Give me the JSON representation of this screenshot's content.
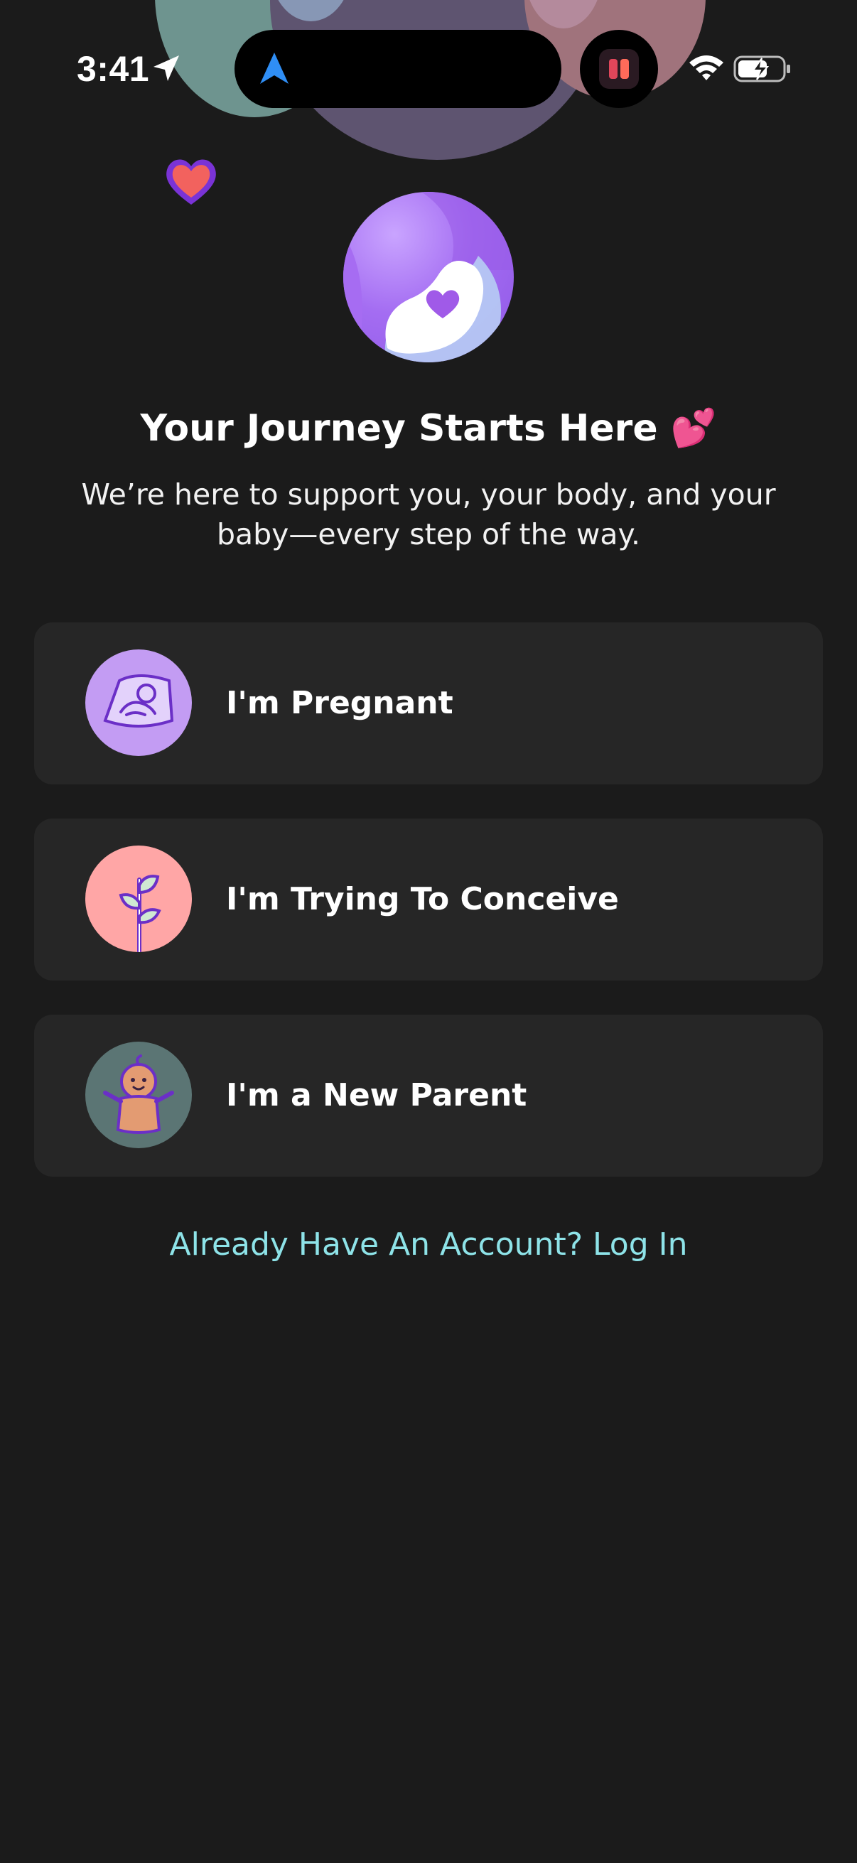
{
  "status_bar": {
    "time": "3:41",
    "icons": [
      "location-arrow-icon",
      "navigation-arrow-icon",
      "app-activity-icon",
      "wifi-icon",
      "battery-charging-icon"
    ]
  },
  "hero": {
    "icon": "pregnant-belly-heart-icon",
    "title": "Your Journey Starts Here 💕",
    "subtitle": "We’re here to support you, your body, and your baby—every step of the way."
  },
  "options": [
    {
      "label": "I'm Pregnant",
      "icon": "ultrasound-icon",
      "icon_bg": "#c39cf3"
    },
    {
      "label": "I'm Trying To Conceive",
      "icon": "sprout-icon",
      "icon_bg": "#ffa6a6"
    },
    {
      "label": "I'm a New Parent",
      "icon": "baby-icon",
      "icon_bg": "#5b7574"
    }
  ],
  "login": {
    "text": "Already Have An Account? Log In"
  },
  "colors": {
    "background": "#1b1b1b",
    "card": "#262626",
    "link": "#8ee3e8",
    "accent_purple": "#a46df2"
  }
}
